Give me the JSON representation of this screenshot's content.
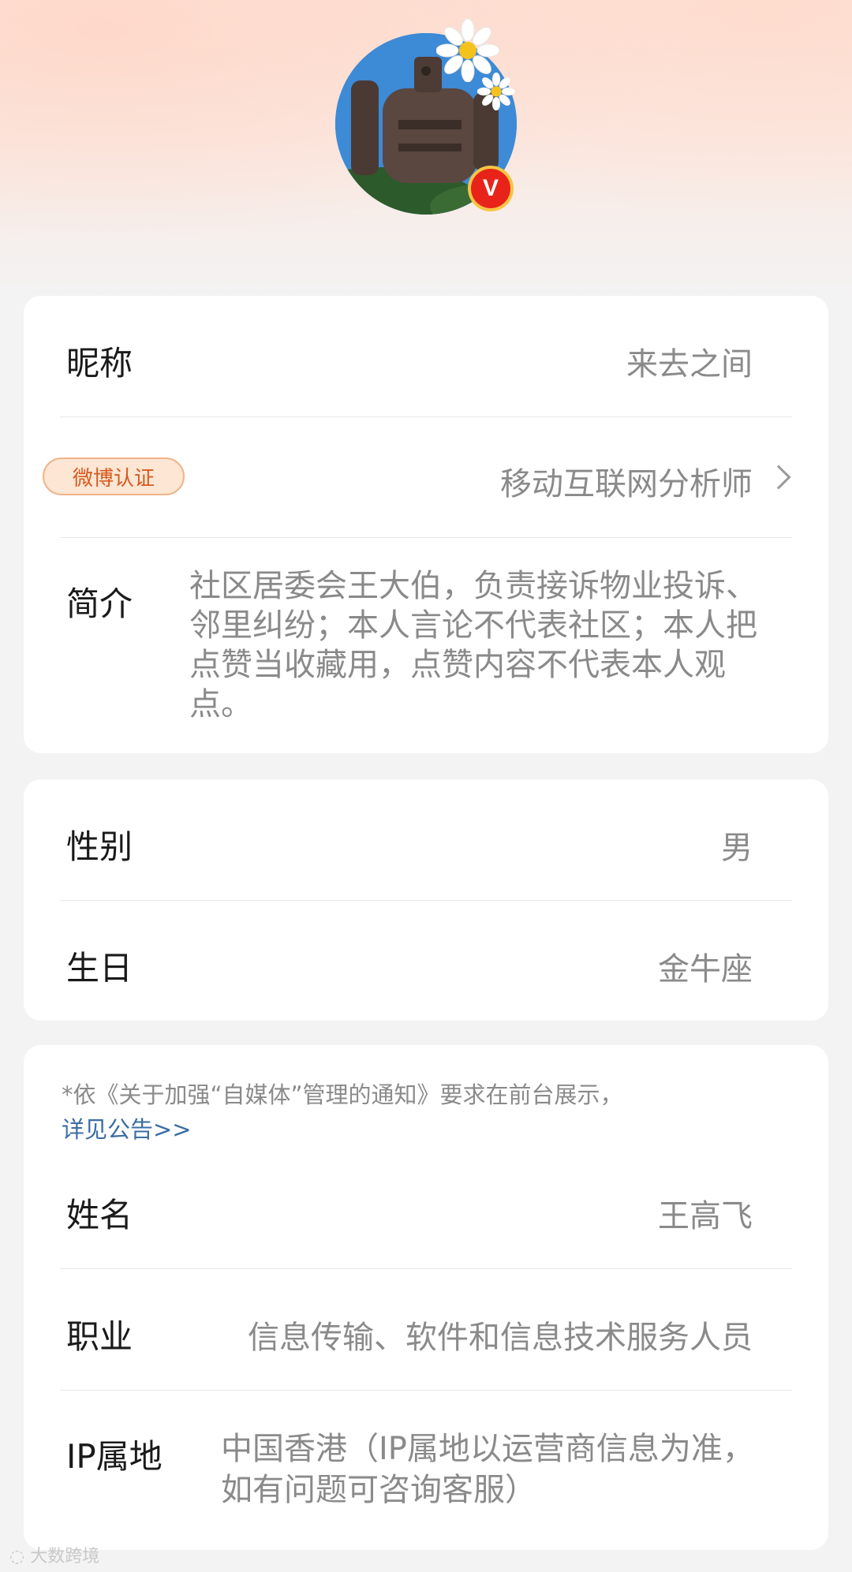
{
  "profile": {
    "avatar_icon": "robot-avatar-icon",
    "verified_icon": "verified-v-icon",
    "verified_glyph": "V"
  },
  "card1": {
    "nickname_label": "昵称",
    "nickname_value": "来去之间",
    "verify_badge": "微博认证",
    "verify_value": "移动互联网分析师",
    "bio_label": "简介",
    "bio_value": "社区居委会王大伯，负责接诉物业投诉、邻里纠纷；本人言论不代表社区；本人把点赞当收藏用，点赞内容不代表本人观点。"
  },
  "card2": {
    "gender_label": "性别",
    "gender_value": "男",
    "birthday_label": "生日",
    "birthday_value": "金牛座"
  },
  "card3": {
    "notice_text": "*依《关于加强“自媒体”管理的通知》要求在前台展示，",
    "notice_link": "详见公告>>",
    "name_label": "姓名",
    "name_value": "王高飞",
    "job_label": "职业",
    "job_value": "信息传输、软件和信息技术服务人员",
    "ip_label": "IP属地",
    "ip_value": "中国香港（IP属地以运营商信息为准，如有问题可咨询客服）"
  },
  "watermark": "大数跨境",
  "colors": {
    "accent_red": "#e8231a",
    "link_blue": "#3b6ea5",
    "badge_orange": "#d65a1f"
  }
}
